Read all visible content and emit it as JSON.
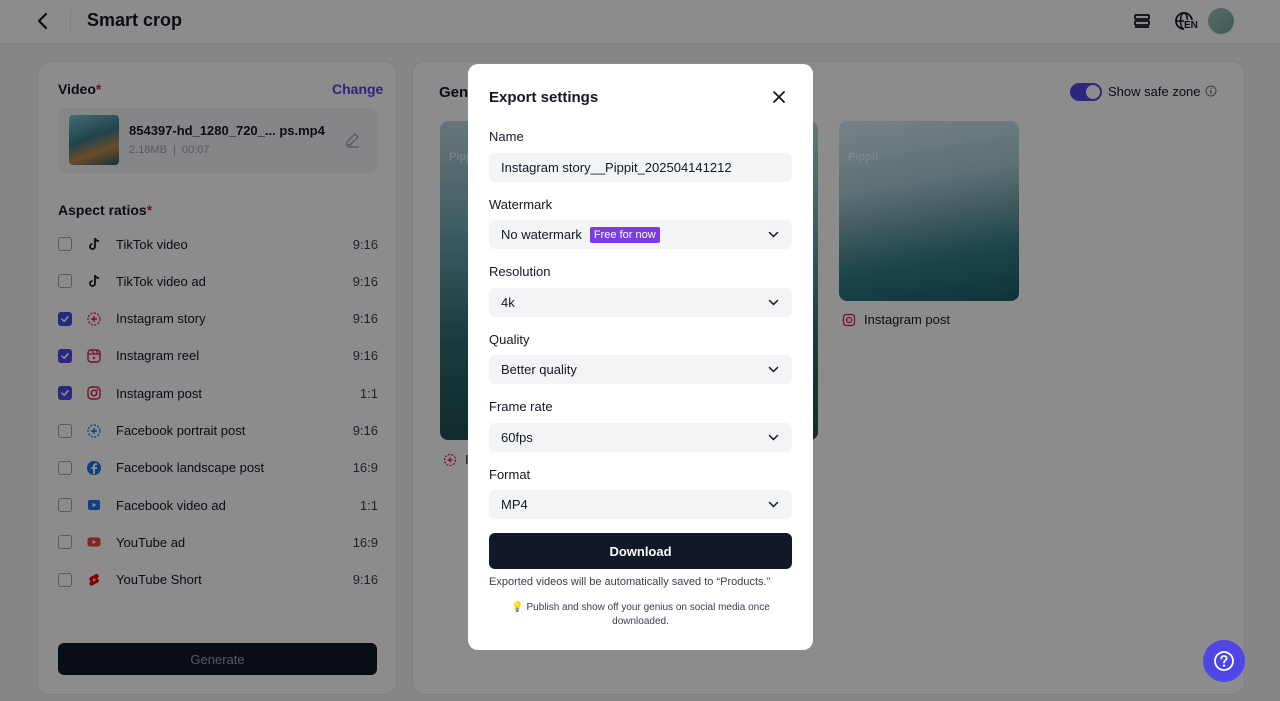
{
  "header": {
    "title": "Smart crop",
    "icons": [
      "back-icon",
      "menu-icon",
      "language-icon",
      "avatar"
    ],
    "language_code": "EN"
  },
  "left": {
    "video_label": "Video",
    "required_mark": "*",
    "change_label": "Change",
    "file": {
      "name": "854397-hd_1280_720_... ps.mp4",
      "size": "2.18MB",
      "duration": "00:07"
    },
    "aspect_label": "Aspect ratios",
    "ratios": [
      {
        "label": "TikTok video",
        "ratio": "9:16",
        "checked": false,
        "icon": "tiktok-icon"
      },
      {
        "label": "TikTok video ad",
        "ratio": "9:16",
        "checked": false,
        "icon": "tiktok-icon"
      },
      {
        "label": "Instagram story",
        "ratio": "9:16",
        "checked": true,
        "icon": "instagram-story-icon"
      },
      {
        "label": "Instagram reel",
        "ratio": "9:16",
        "checked": true,
        "icon": "instagram-reel-icon"
      },
      {
        "label": "Instagram post",
        "ratio": "1:1",
        "checked": true,
        "icon": "instagram-icon"
      },
      {
        "label": "Facebook portrait post",
        "ratio": "9:16",
        "checked": false,
        "icon": "facebook-portrait-icon"
      },
      {
        "label": "Facebook landscape post",
        "ratio": "16:9",
        "checked": false,
        "icon": "facebook-icon"
      },
      {
        "label": "Facebook video ad",
        "ratio": "1:1",
        "checked": false,
        "icon": "facebook-video-icon"
      },
      {
        "label": "YouTube ad",
        "ratio": "16:9",
        "checked": false,
        "icon": "youtube-icon"
      },
      {
        "label": "YouTube Short",
        "ratio": "9:16",
        "checked": false,
        "icon": "youtube-shorts-icon"
      }
    ],
    "generate_label": "Generate"
  },
  "right": {
    "title_visible": "Gen",
    "safe_zone_label": "Show safe zone",
    "safe_zone_on": true,
    "watermark": "Pippit",
    "story_caption": "I",
    "post_caption": "Instagram post"
  },
  "modal": {
    "title": "Export settings",
    "name_label": "Name",
    "name_value": "Instagram story__Pippit_202504141212",
    "watermark_label": "Watermark",
    "watermark_value": "No watermark",
    "watermark_badge": "Free for now",
    "resolution_label": "Resolution",
    "resolution_value": "4k",
    "quality_label": "Quality",
    "quality_value": "Better quality",
    "framerate_label": "Frame rate",
    "framerate_value": "60fps",
    "format_label": "Format",
    "format_value": "MP4",
    "download_label": "Download",
    "note": "Exported videos will be automatically saved to “Products.”",
    "tip": "💡 Publish and show off your genius on social media once downloaded."
  },
  "colors": {
    "accent": "#4f46e5",
    "badge": "#7c3aed",
    "dark": "#111827"
  }
}
